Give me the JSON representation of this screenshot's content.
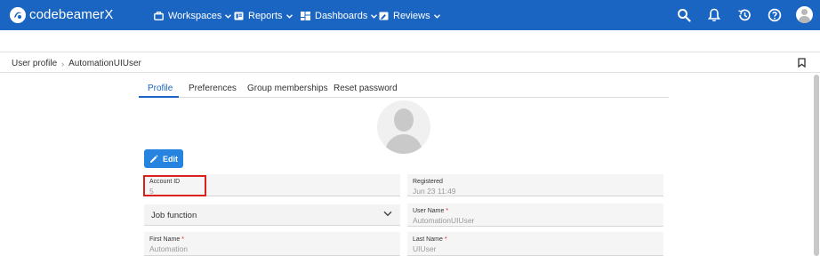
{
  "app": {
    "brand": "codebeamerX"
  },
  "nav": {
    "items": [
      {
        "label": "Workspaces",
        "icon": "briefcase-icon"
      },
      {
        "label": "Reports",
        "icon": "reports-icon"
      },
      {
        "label": "Dashboards",
        "icon": "dashboard-icon"
      },
      {
        "label": "Reviews",
        "icon": "reviews-icon"
      }
    ],
    "right_icons": [
      "search-icon",
      "bell-icon",
      "history-icon",
      "help-icon",
      "user-avatar"
    ]
  },
  "breadcrumb": {
    "items": [
      "User profile",
      "AutomationUIUser"
    ]
  },
  "tabs": [
    {
      "label": "Profile",
      "active": true
    },
    {
      "label": "Preferences",
      "active": false
    },
    {
      "label": "Group memberships",
      "active": false
    },
    {
      "label": "Reset password",
      "active": false
    }
  ],
  "edit_button": {
    "label": "Edit"
  },
  "fields": {
    "account_id": {
      "label": "Account ID",
      "value": "5"
    },
    "registered": {
      "label": "Registered",
      "value": "Jun 23 11:49"
    },
    "job_function": {
      "placeholder": "Job function"
    },
    "user_name": {
      "label": "User Name",
      "required_mark": "*",
      "value": "AutomationUIUser"
    },
    "first_name": {
      "label": "First Name",
      "required_mark": "*",
      "value": "Automation"
    },
    "last_name": {
      "label": "Last Name",
      "required_mark": "*",
      "value": "UIUser"
    }
  },
  "colors": {
    "topbar": "#1a64c2",
    "accent": "#2684e0",
    "highlight": "#d9221c",
    "required": "#e02020"
  }
}
